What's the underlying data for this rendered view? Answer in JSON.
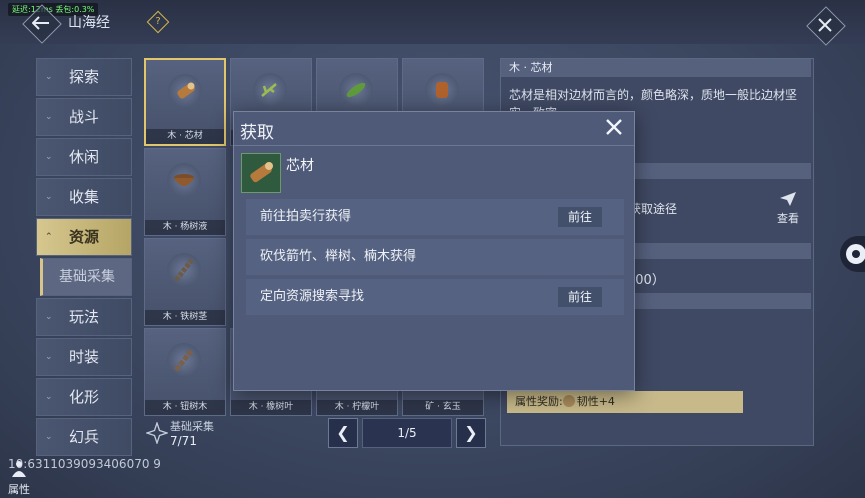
{
  "net_status": "延迟:12ms  丢包:0.3%",
  "header": {
    "title": "山海经",
    "help_icon": "?"
  },
  "sidebar": {
    "items": [
      {
        "label": "探索"
      },
      {
        "label": "战斗"
      },
      {
        "label": "休闲"
      },
      {
        "label": "收集"
      },
      {
        "label": "资源"
      },
      {
        "label": "基础采集"
      },
      {
        "label": "玩法"
      },
      {
        "label": "时装"
      },
      {
        "label": "化形"
      },
      {
        "label": "幻兵"
      }
    ]
  },
  "grid": {
    "items": [
      {
        "label": "木 · 芯材"
      },
      {
        "label": ""
      },
      {
        "label": ""
      },
      {
        "label": ""
      },
      {
        "label": "木 · 杨树液"
      },
      {
        "label": "木 · 铁树茎"
      },
      {
        "label": "木 · 钮树木"
      },
      {
        "label": "木 · 橡树叶"
      },
      {
        "label": "木 · 柠檬叶"
      },
      {
        "label": "矿 · 玄玉"
      }
    ],
    "footer_label": "基础采集",
    "count": "7/71",
    "page": "1/5"
  },
  "detail": {
    "header": "木 · 芯材",
    "description": "芯材是相对边材而言的，颜色略深，质地一般比边材坚实、致密。",
    "source_text": "获取途径",
    "view_label": "查看",
    "value_text": "200）",
    "reward_label": "属性奖励:",
    "reward_value": "韧性+4"
  },
  "modal": {
    "title": "获取",
    "item_name": "芯材",
    "rows": [
      {
        "text": "前往拍卖行获得",
        "action": "前往"
      },
      {
        "text": "砍伐箭竹、榉树、楠木获得",
        "action": ""
      },
      {
        "text": "定向资源搜索寻找",
        "action": "前往"
      }
    ]
  },
  "bottom": {
    "uid": "10:6311039093406070 9",
    "attr_label": "属性"
  },
  "colors": {
    "accent_gold": "#e2c66b",
    "panel": "#4e5a78"
  }
}
